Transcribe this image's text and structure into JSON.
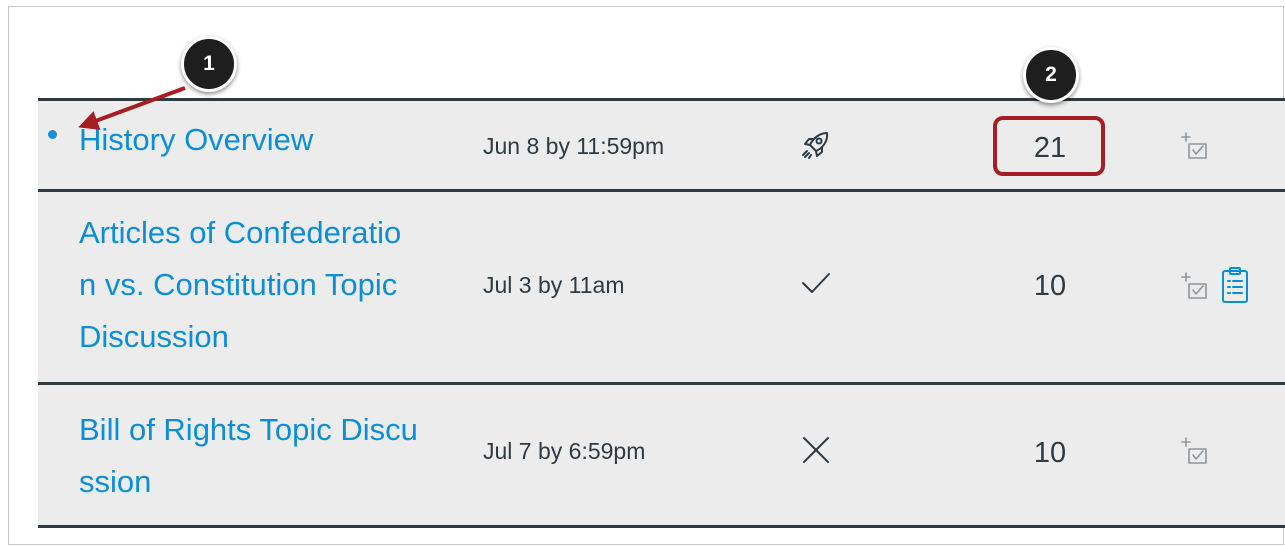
{
  "discussions": [
    {
      "title": "History Overview",
      "title_lines": [
        "History Overview"
      ],
      "due": "Jun 8 by 11:59pm",
      "status_icon": "rocket-icon",
      "points": "21",
      "unread": true,
      "has_rubric": false
    },
    {
      "title": "Articles of Confederation vs. Constitution Topic Discussion",
      "title_lines": [
        "Articles of Confederatio",
        "n vs. Constitution Topic",
        "Discussion"
      ],
      "due": "Jul 3 by 11am",
      "status_icon": "checkmark-icon",
      "points": "10",
      "unread": false,
      "has_rubric": true
    },
    {
      "title": "Bill of Rights Topic Discussion",
      "title_lines": [
        "Bill of Rights Topic Discu",
        "ssion"
      ],
      "due": "Jul 7 by 6:59pm",
      "status_icon": "close-x-icon",
      "points": "10",
      "unread": false,
      "has_rubric": false
    }
  ],
  "callouts": [
    "1",
    "2"
  ],
  "colors": {
    "link": "#0b8ed8",
    "text": "#2d3b45",
    "row_background": "#ececec",
    "divider": "#2d3b45",
    "highlight": "#a61d22",
    "callout_bg": "#1e1e1e",
    "unread_dot": "#1a8fd6",
    "icon_gray": "#8b969e"
  }
}
